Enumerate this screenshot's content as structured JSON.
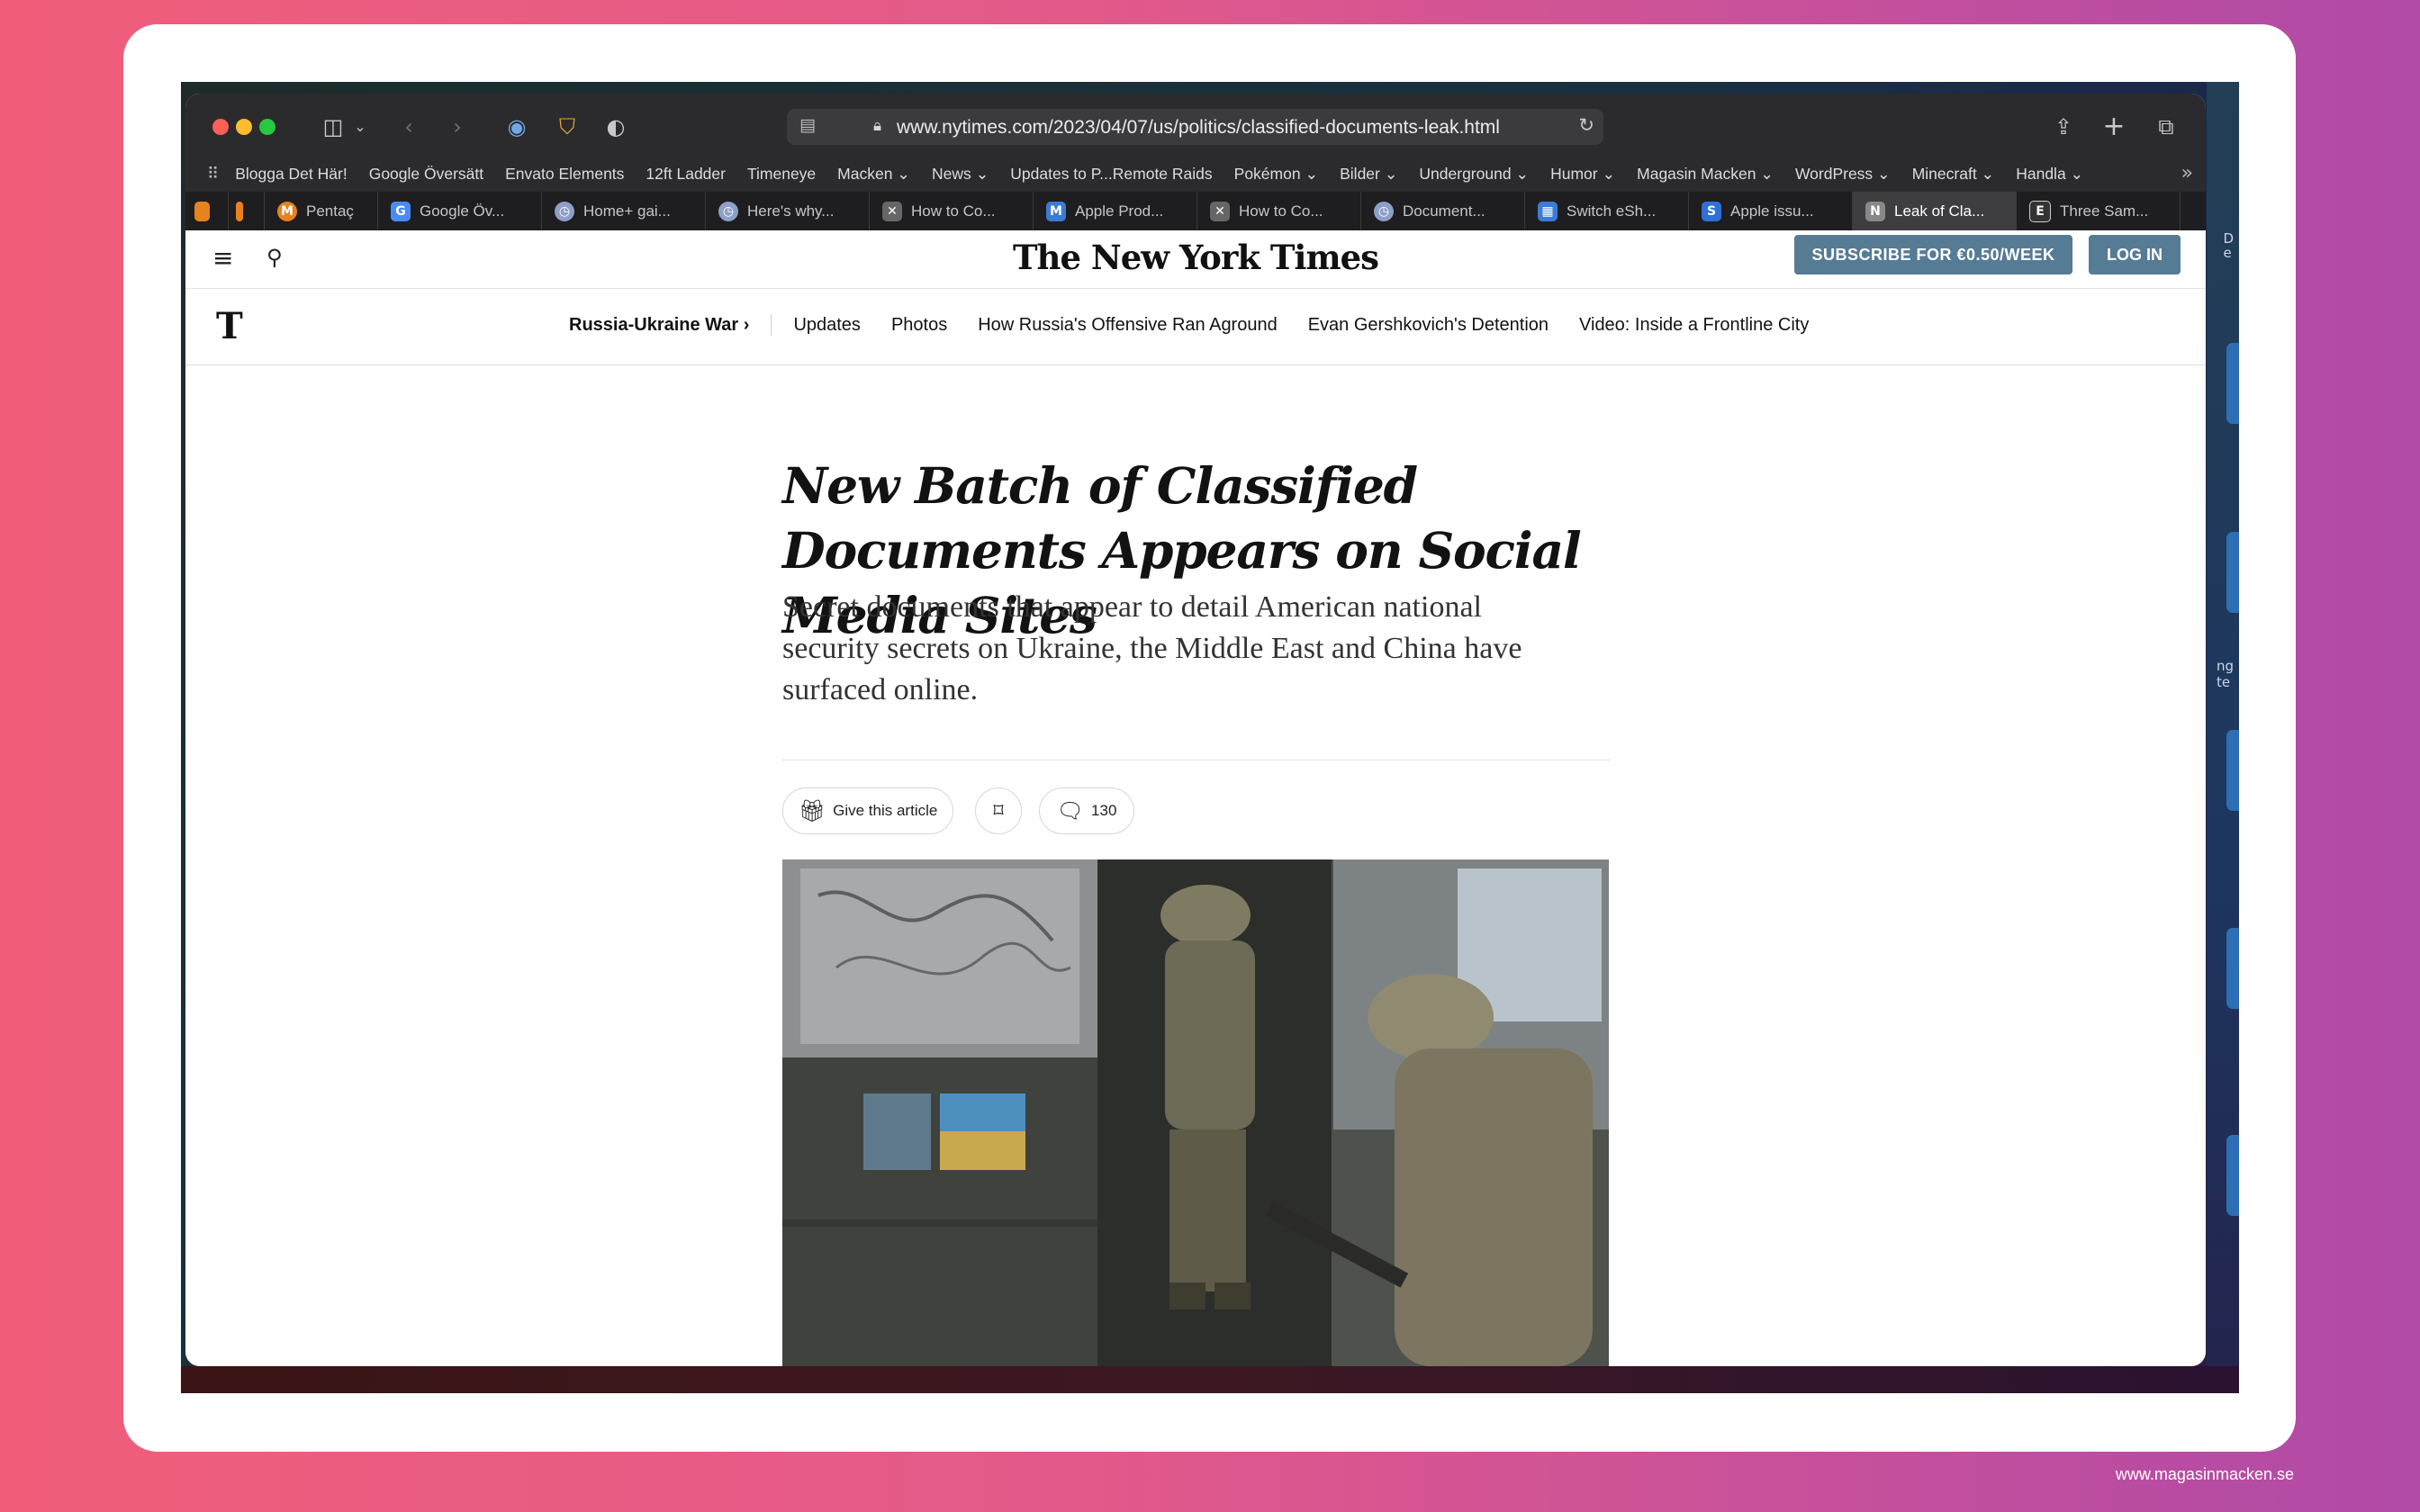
{
  "browser": {
    "url": "www.nytimes.com/2023/04/07/us/politics/classified-documents-leak.html",
    "icons": [
      "sidebar-icon",
      "chevron-down-icon",
      "back-icon",
      "forward-icon",
      "password-icon",
      "shield-check-icon",
      "privacy-shield-icon",
      "share-icon",
      "new-tab-icon",
      "tab-overview-icon"
    ],
    "bookmarks": [
      "Blogga Det Här!",
      "Google Översätt",
      "Envato Elements",
      "12ft Ladder",
      "Timeneye",
      "Macken ⌄",
      "News ⌄",
      "Updates to P...Remote Raids",
      "Pokémon ⌄",
      "Bilder ⌄",
      "Underground ⌄",
      "Humor ⌄",
      "Magasin Macken ⌄",
      "WordPress ⌄",
      "Minecraft ⌄",
      "Handla ⌄"
    ],
    "tabs": [
      {
        "label": "",
        "favicon": "",
        "color": "#e8821e"
      },
      {
        "label": "",
        "favicon": "",
        "color": "#e8821e"
      },
      {
        "label": "Pentaç",
        "favicon": "M",
        "color": "#e8821e"
      },
      {
        "label": "Google Öv...",
        "favicon": "G",
        "color": "#4a8af4"
      },
      {
        "label": "Home+ gai...",
        "favicon": "◷",
        "color": "#8ea0c8"
      },
      {
        "label": "Here's why...",
        "favicon": "◷",
        "color": "#8ea0c8"
      },
      {
        "label": "How to Co...",
        "favicon": "✕",
        "color": "#666666"
      },
      {
        "label": "Apple Prod...",
        "favicon": "M",
        "color": "#3a7bd5"
      },
      {
        "label": "How to Co...",
        "favicon": "✕",
        "color": "#666666"
      },
      {
        "label": "Document...",
        "favicon": "◷",
        "color": "#8ea0c8"
      },
      {
        "label": "Switch eSh...",
        "favicon": "▦",
        "color": "#3a7bd5"
      },
      {
        "label": "Apple issu...",
        "favicon": "S",
        "color": "#2f6fd6"
      },
      {
        "label": "Leak of Cla...",
        "favicon": "N",
        "color": "#888888",
        "active": true
      },
      {
        "label": "Three Sam...",
        "favicon": "E",
        "color": "#333333"
      }
    ]
  },
  "nyt": {
    "logo": "The New York Times",
    "t_logo": "T",
    "subscribe": "SUBSCRIBE FOR €0.50/WEEK",
    "login": "LOG IN",
    "section": "Russia-Ukraine War ›",
    "nav": [
      "Updates",
      "Photos",
      "How Russia's Offensive Ran Aground",
      "Evan Gershkovich's Detention",
      "Video: Inside a Frontline City"
    ]
  },
  "article": {
    "headline": "New Batch of Classified Documents Appears on Social Media Sites",
    "summary": "Secret documents that appear to detail American national security secrets on Ukraine, the Middle East and China have surfaced online.",
    "gift_label": "Give this article",
    "comments": "130",
    "photo_alt": "Two Ukrainian soldiers in camouflage and helmets stepping off a bus with a Ukrainian flag on its side"
  },
  "side_text": {
    "top": "D\ne",
    "mid": "ng\nte"
  },
  "footer_credit": "www.magasinmacken.se",
  "colors": {
    "background_left": "#f05e7a",
    "background_right": "#b04aa6",
    "nyt_button": "#567b95",
    "active_tab": "#3e3e41"
  }
}
